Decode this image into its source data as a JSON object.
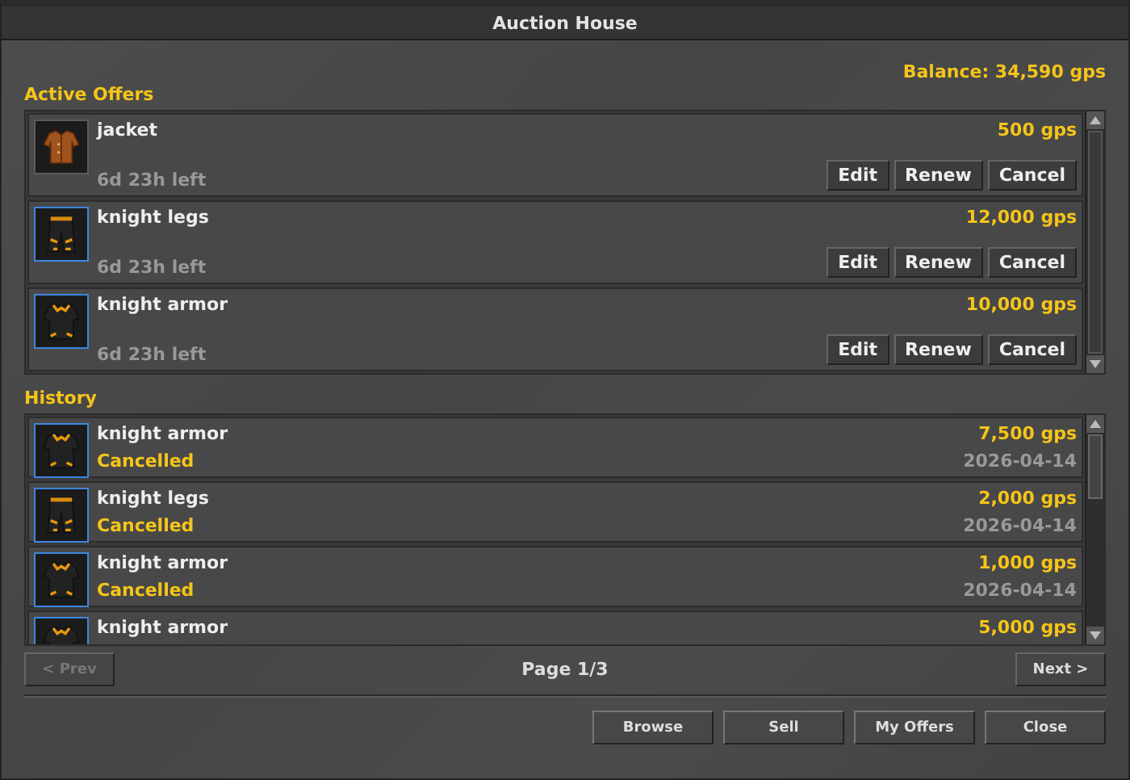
{
  "window": {
    "title": "Auction House"
  },
  "balance": "Balance: 34,590 gps",
  "active_offers": {
    "title": "Active Offers",
    "items": [
      {
        "name": "jacket",
        "kind": "jacket",
        "color": "#5c5c5c",
        "price": "500 gps",
        "time_left": "6d 23h left",
        "buttons": [
          "Edit",
          "Renew",
          "Cancel"
        ]
      },
      {
        "name": "knight legs",
        "kind": "legs",
        "color": "#3d86e0",
        "price": "12,000 gps",
        "time_left": "6d 23h left",
        "buttons": [
          "Edit",
          "Renew",
          "Cancel"
        ]
      },
      {
        "name": "knight armor",
        "kind": "armor",
        "color": "#3d86e0",
        "price": "10,000 gps",
        "time_left": "6d 23h left",
        "buttons": [
          "Edit",
          "Renew",
          "Cancel"
        ]
      }
    ]
  },
  "history": {
    "title": "History",
    "items": [
      {
        "name": "knight armor",
        "kind": "armor",
        "color": "#3d86e0",
        "price": "7,500 gps",
        "status": "Cancelled",
        "date": "2026-04-14"
      },
      {
        "name": "knight legs",
        "kind": "legs",
        "color": "#3d86e0",
        "price": "2,000 gps",
        "status": "Cancelled",
        "date": "2026-04-14"
      },
      {
        "name": "knight armor",
        "kind": "armor",
        "color": "#3d86e0",
        "price": "1,000 gps",
        "status": "Cancelled",
        "date": "2026-04-14"
      },
      {
        "name": "knight armor",
        "kind": "armor",
        "color": "#3d86e0",
        "price": "5,000 gps"
      }
    ]
  },
  "pager": {
    "prev": {
      "label": "< Prev",
      "disabled": true
    },
    "page": "Page 1/3",
    "next": {
      "label": "Next >",
      "disabled": false
    }
  },
  "buttons": [
    "Browse",
    "Sell",
    "My Offers",
    "Close"
  ]
}
